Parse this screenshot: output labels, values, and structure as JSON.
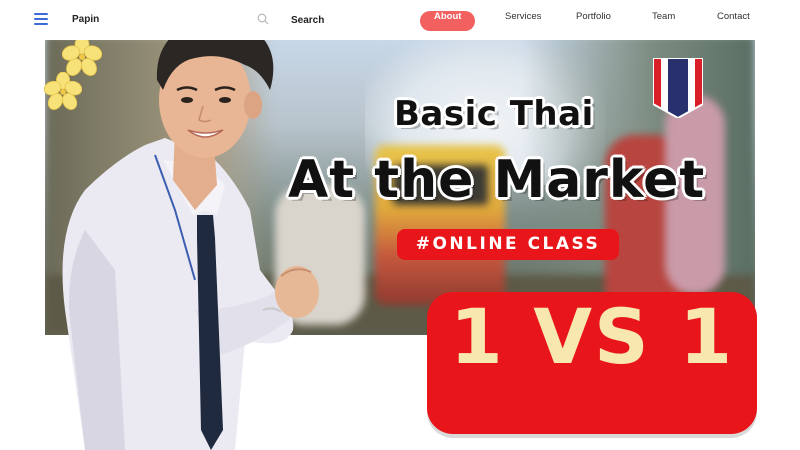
{
  "nav": {
    "brand": "Papin",
    "search_label": "Search",
    "links": [
      {
        "label": "About",
        "active": true
      },
      {
        "label": "Services",
        "active": false
      },
      {
        "label": "Portfolio",
        "active": false
      },
      {
        "label": "Team",
        "active": false
      },
      {
        "label": "Contact",
        "active": false
      }
    ]
  },
  "hero": {
    "title_line1": "Basic Thai",
    "title_line2": "At the Market",
    "badge": "#ONLINE CLASS",
    "session_type": "1 VS 1"
  },
  "icons": [
    "menu-icon",
    "search-icon",
    "flower-icon",
    "thai-flag-icon"
  ],
  "colors": {
    "accent": "#f26060",
    "badge_red": "#e8161a",
    "vs_text": "#f8e8b0",
    "menu_blue": "#3a6bd6"
  }
}
